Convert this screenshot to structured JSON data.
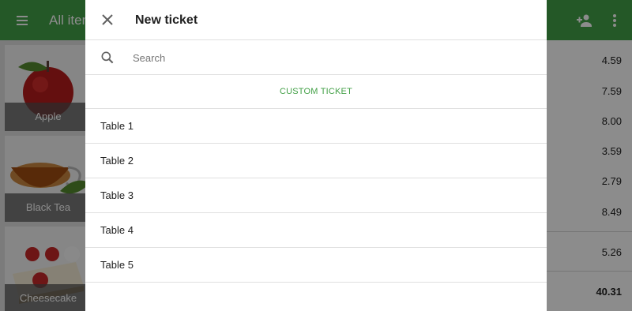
{
  "app": {
    "title": "All items"
  },
  "grid": {
    "items": [
      {
        "name": "Apple"
      },
      {
        "name": "Black Tea"
      },
      {
        "name": "Cheesecake"
      }
    ]
  },
  "ticket": {
    "prices": [
      "4.59",
      "7.59",
      "8.00",
      "3.59",
      "2.79",
      "8.49",
      "5.26"
    ],
    "total": "40.31"
  },
  "dialog": {
    "title": "New ticket",
    "search_placeholder": "Search",
    "custom_ticket_label": "CUSTOM TICKET",
    "tables": [
      {
        "label": "Table 1"
      },
      {
        "label": "Table 2"
      },
      {
        "label": "Table 3"
      },
      {
        "label": "Table 4"
      },
      {
        "label": "Table 5"
      }
    ]
  },
  "colors": {
    "brand_green": "#43a047"
  },
  "icons": [
    "menu-icon",
    "add-person-icon",
    "more-vert-icon",
    "close-icon",
    "search-icon"
  ]
}
